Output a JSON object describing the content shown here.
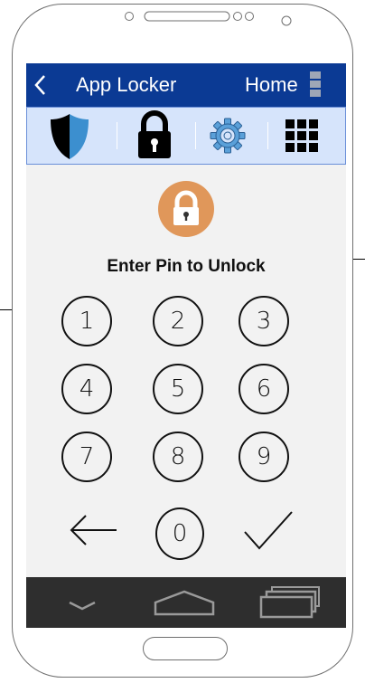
{
  "header": {
    "title": "App Locker",
    "home_label": "Home"
  },
  "tabs": [
    {
      "icon": "shield-icon"
    },
    {
      "icon": "padlock-icon"
    },
    {
      "icon": "gear-icon"
    },
    {
      "icon": "grid-icon"
    }
  ],
  "lock_screen": {
    "prompt": "Enter Pin to Unlock",
    "keys": [
      "1",
      "2",
      "3",
      "4",
      "5",
      "6",
      "7",
      "8",
      "9",
      "0"
    ],
    "backspace_icon": "arrow-left-icon",
    "confirm_icon": "checkmark-icon"
  },
  "nav": {
    "back_icon": "chevron-down-icon",
    "home_icon": "home-outline-icon",
    "recents_icon": "recent-apps-icon"
  },
  "colors": {
    "header_bg": "#0b3a94",
    "tabbar_bg": "#d6e4fb",
    "screen_bg": "#f2f2f2",
    "navbar_bg": "#2e2e2e",
    "lock_badge": "#e0975a"
  }
}
